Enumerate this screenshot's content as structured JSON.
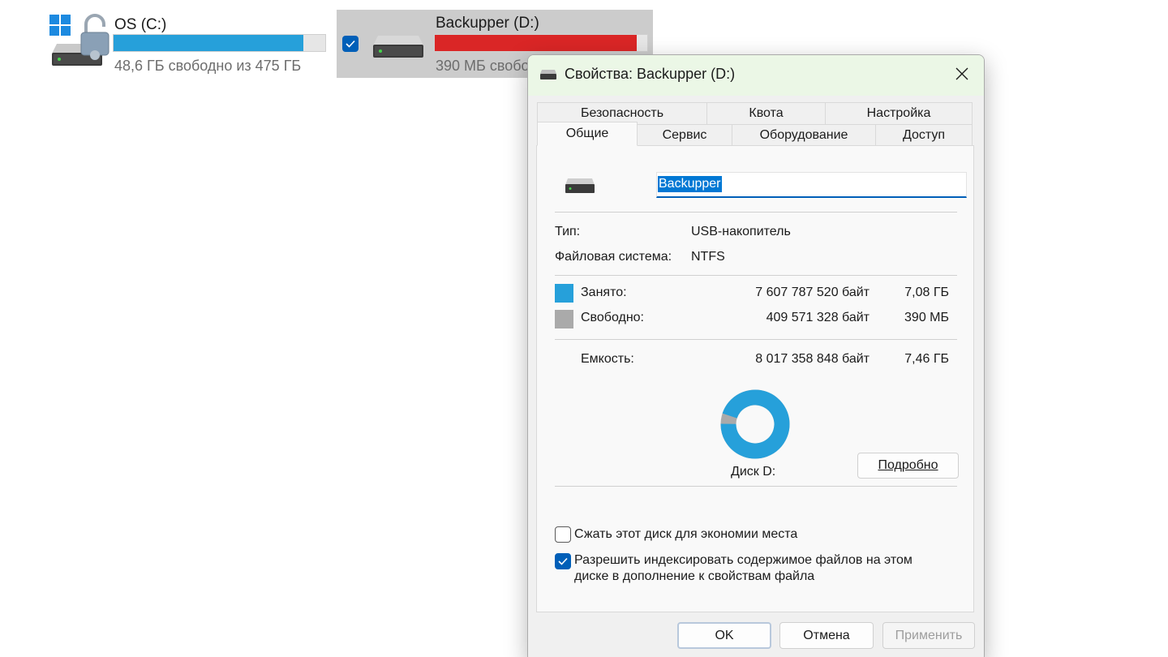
{
  "drives": [
    {
      "name": "OS (C:)",
      "free_text": "48,6 ГБ свободно из 475 ГБ",
      "used_fraction": 0.898,
      "bar_color": "#26a0da",
      "selected": false,
      "icons": [
        "windows-logo",
        "hdd-icon",
        "lock-icon"
      ]
    },
    {
      "name": "Backupper (D:)",
      "free_text": "390 МБ свобо",
      "used_fraction": 0.949,
      "bar_color": "#da2626",
      "selected": true,
      "icons": [
        "checkbox-checked",
        "hdd-icon"
      ]
    }
  ],
  "dialog": {
    "title": "Свойства: Backupper (D:)",
    "title_icon": "usb-drive-icon",
    "close_icon": "close-icon",
    "tabs_back": [
      "Безопасность",
      "Квота",
      "Настройка"
    ],
    "tabs_front": [
      "Общие",
      "Сервис",
      "Оборудование",
      "Доступ"
    ],
    "active_tab": "Общие",
    "general": {
      "volume_label": "Backupper",
      "type_label": "Тип:",
      "type_value": "USB-накопитель",
      "fs_label": "Файловая система:",
      "fs_value": "NTFS",
      "used_label": "Занято:",
      "used_bytes": "7 607 787 520 байт",
      "used_human": "7,08 ГБ",
      "free_label": "Свободно:",
      "free_bytes": "409 571 328 байт",
      "free_human": "390 МБ",
      "capacity_label": "Емкость:",
      "capacity_bytes": "8 017 358 848 байт",
      "capacity_human": "7,46 ГБ",
      "disk_label": "Диск D:",
      "details_button": "Подробно",
      "compress_label": "Сжать этот диск для экономии места",
      "compress_checked": false,
      "index_label": "Разрешить индексировать содержимое файлов на этом диске в дополнение к свойствам файла",
      "index_checked": true,
      "used_fraction": 0.9489,
      "used_color": "#26a0da",
      "free_color": "#aaaaaa"
    },
    "buttons": {
      "ok": "OK",
      "cancel": "Отмена",
      "apply": "Применить",
      "apply_enabled": false
    }
  }
}
